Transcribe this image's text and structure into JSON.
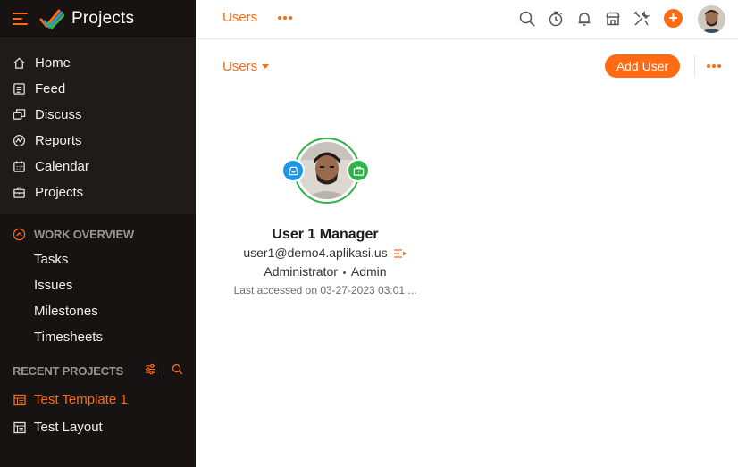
{
  "app": {
    "title": "Projects"
  },
  "colors": {
    "accent": "#ff6a13",
    "sidebar_bg": "#1e1b1a",
    "status_green": "#2eb34a",
    "badge_blue": "#1e96e8"
  },
  "sidebar": {
    "main_items": [
      {
        "label": "Home",
        "icon": "home-icon"
      },
      {
        "label": "Feed",
        "icon": "feed-icon"
      },
      {
        "label": "Discuss",
        "icon": "discuss-icon"
      },
      {
        "label": "Reports",
        "icon": "reports-icon"
      },
      {
        "label": "Calendar",
        "icon": "calendar-icon"
      },
      {
        "label": "Projects",
        "icon": "projects-icon"
      }
    ],
    "work_overview": {
      "title": "WORK OVERVIEW",
      "items": [
        "Tasks",
        "Issues",
        "Milestones",
        "Timesheets"
      ]
    },
    "recent_projects": {
      "title": "RECENT PROJECTS",
      "items": [
        {
          "label": "Test Template 1",
          "active": true
        },
        {
          "label": "Test Layout",
          "active": false
        }
      ]
    }
  },
  "topbar": {
    "active_tab": "Users",
    "icons": [
      "search-icon",
      "timer-icon",
      "bell-icon",
      "store-icon",
      "tools-icon",
      "plus-icon",
      "avatar"
    ],
    "plus_label": "+"
  },
  "content": {
    "view_selector": "Users",
    "add_button": "Add User"
  },
  "user_card": {
    "name": "User 1 Manager",
    "email": "user1@demo4.aplikasi.us",
    "role": "Administrator",
    "profile": "Admin",
    "last_accessed": "Last accessed on 03-27-2023 03:01 ..."
  }
}
